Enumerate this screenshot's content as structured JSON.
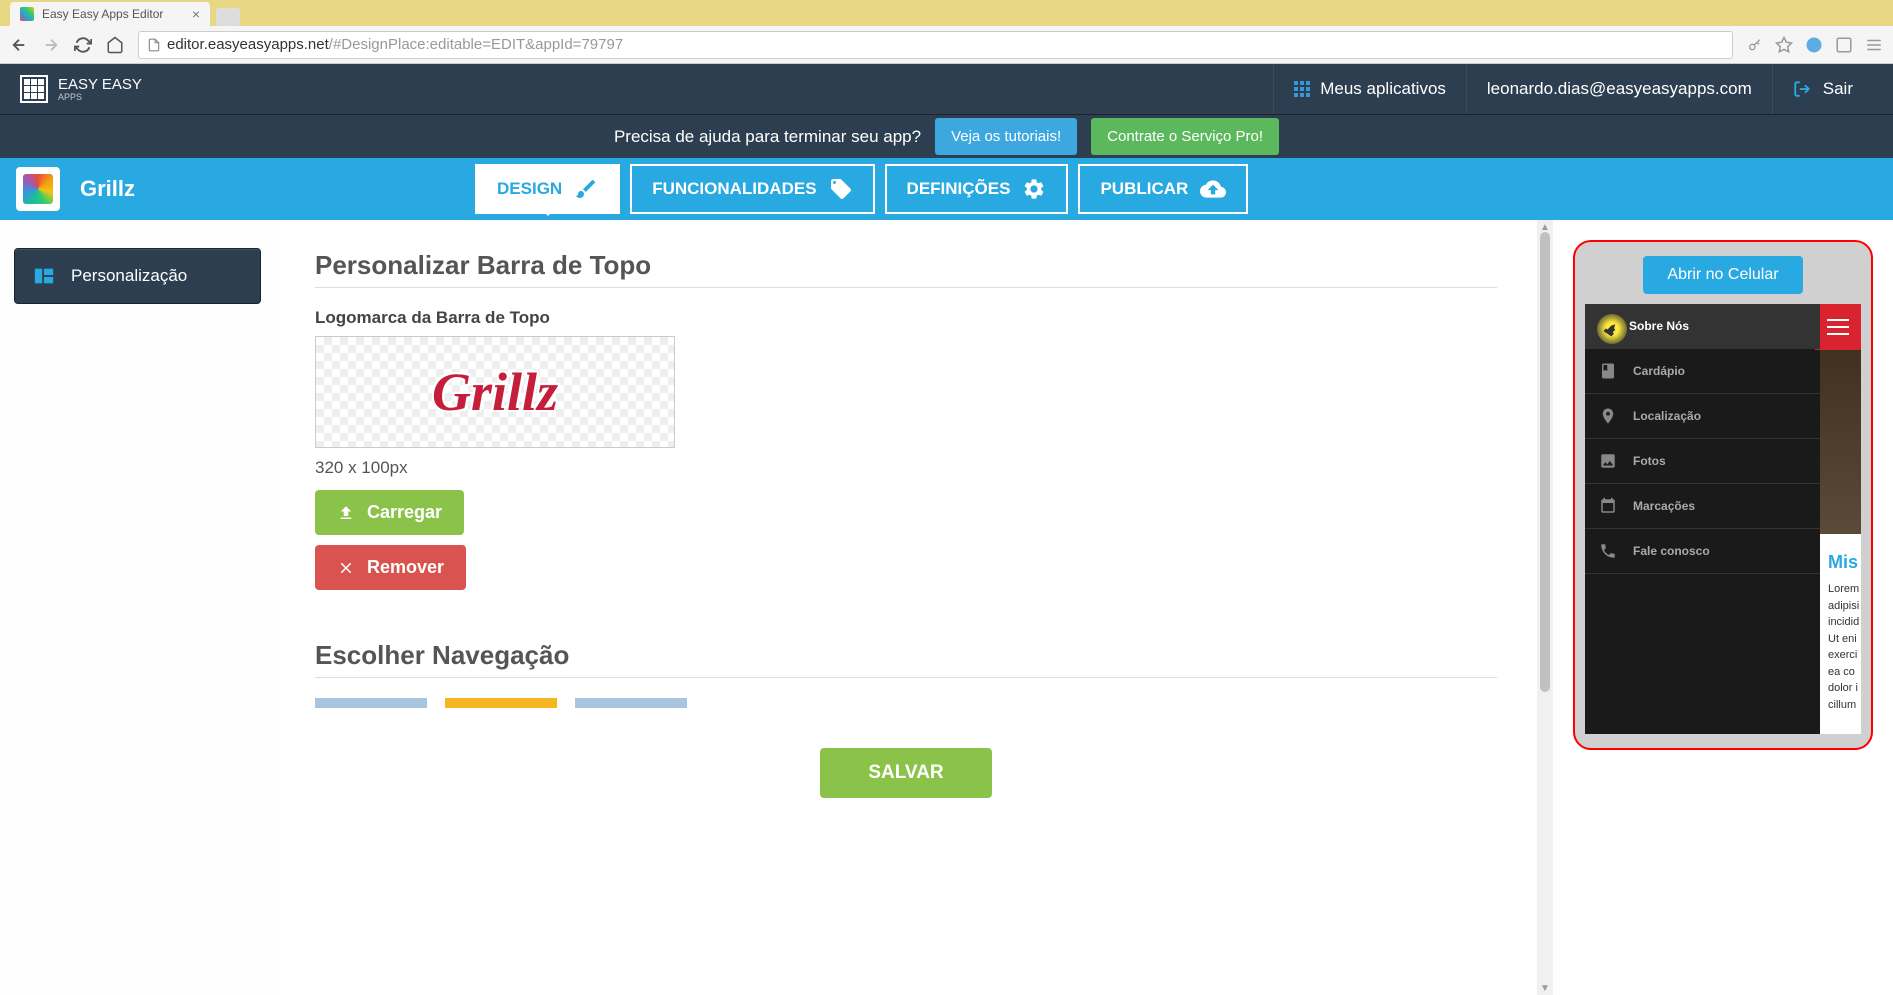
{
  "browser": {
    "tab_title": "Easy Easy Apps Editor",
    "url_host": "editor.easyeasyapps.net",
    "url_path": "/#DesignPlace:editable=EDIT&appId=79797"
  },
  "header": {
    "brand": "EASY EASY",
    "brand_sub": "APPS",
    "my_apps": "Meus aplicativos",
    "user_email": "leonardo.dias@easyeasyapps.com",
    "logout": "Sair"
  },
  "banner": {
    "text": "Precisa de ajuda para terminar seu app?",
    "tutorials": "Veja os tutoriais!",
    "pro_service": "Contrate o Serviço Pro!"
  },
  "nav": {
    "app_name": "Grillz",
    "tabs": {
      "design": "DESIGN",
      "features": "FUNCIONALIDADES",
      "settings": "DEFINIÇÕES",
      "publish": "PUBLICAR"
    }
  },
  "sidebar": {
    "personalization": "Personalização"
  },
  "editor": {
    "section_title": "Personalizar Barra de Topo",
    "logo_label": "Logomarca da Barra de Topo",
    "logo_text": "Grillz",
    "dimensions": "320 x 100px",
    "upload": "Carregar",
    "remove": "Remover",
    "nav_section": "Escolher Navegação",
    "save": "SALVAR"
  },
  "preview": {
    "open_mobile": "Abrir no Celular",
    "menu": {
      "about": "Sobre Nós",
      "menu": "Cardápio",
      "location": "Localização",
      "photos": "Fotos",
      "bookings": "Marcações",
      "contact": "Fale conosco"
    },
    "content_title": "Mis",
    "content_body": "Lorem adipisi incidid Ut eni exerci ea co dolor i cillum"
  }
}
